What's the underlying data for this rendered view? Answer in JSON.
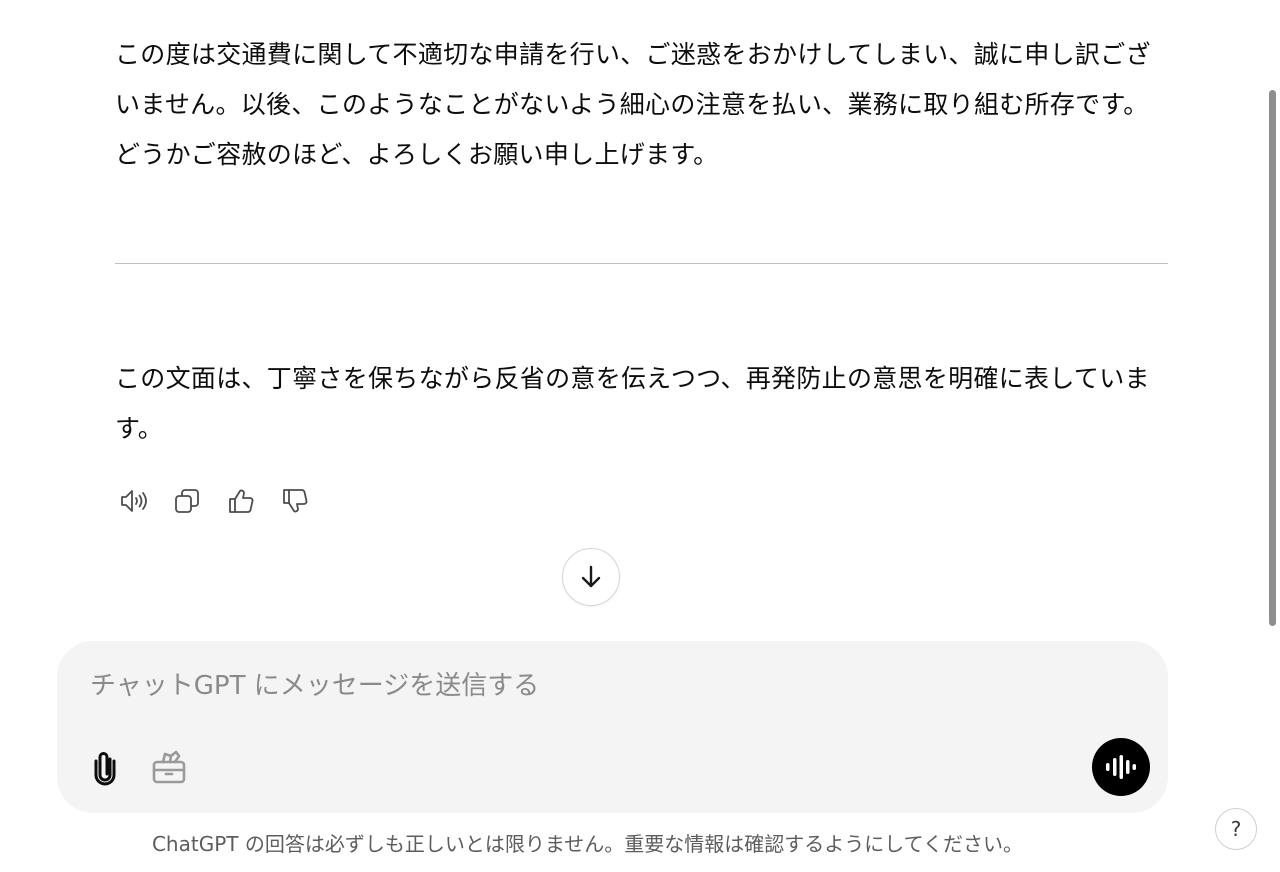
{
  "message": {
    "paragraph1": "この度は交通費に関して不適切な申請を行い、ご迷惑をおかけしてしまい、誠に申し訳ございません。以後、このようなことがないよう細心の注意を払い、業務に取り組む所存です。どうかご容赦のほど、よろしくお願い申し上げます。",
    "paragraph2": "この文面は、丁寧さを保ちながら反省の意を伝えつつ、再発防止の意思を明確に表しています。"
  },
  "actions": {
    "icons": [
      "speaker-icon",
      "copy-icon",
      "thumbs-up-icon",
      "thumbs-down-icon"
    ]
  },
  "composer": {
    "placeholder": "チャットGPT にメッセージを送信する"
  },
  "footer": {
    "disclaimer": "ChatGPT の回答は必ずしも正しいとは限りません。重要な情報は確認するようにしてください。",
    "help_label": "?"
  },
  "colors": {
    "composer_bg": "#f4f4f4",
    "voice_button_bg": "#000000",
    "placeholder_text": "#8a8a8a"
  }
}
